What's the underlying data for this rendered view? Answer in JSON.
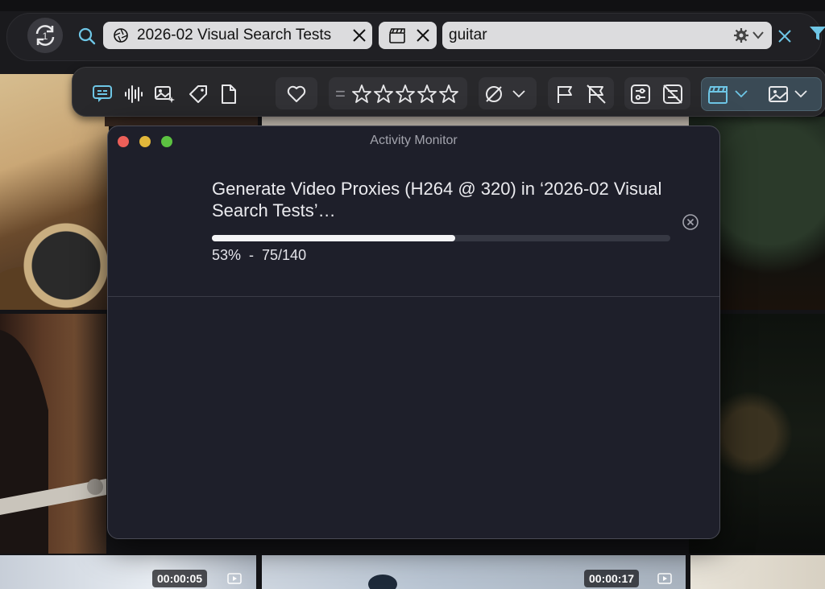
{
  "search": {
    "collection_chip": "2026-02 Visual Search Tests",
    "type_chip_icon": "clapperboard-icon",
    "query": "guitar",
    "sync_badge": "1"
  },
  "filters": {
    "rating_prefix": "=",
    "rating_stars": 5
  },
  "grid": {
    "durations": [
      "00:00:05",
      "00:00:17"
    ]
  },
  "activity_monitor": {
    "title": "Activity Monitor",
    "task": "Generate Video Proxies (H264 @ 320) in ‘2026-02 Visual Search Tests’…",
    "progress": 0.53,
    "progress_text": "53%  -  75/140"
  },
  "colors": {
    "accent": "#6ec6e6",
    "traffic_red": "#ec5f59",
    "traffic_yellow": "#e2b73a",
    "traffic_green": "#5cc241"
  }
}
